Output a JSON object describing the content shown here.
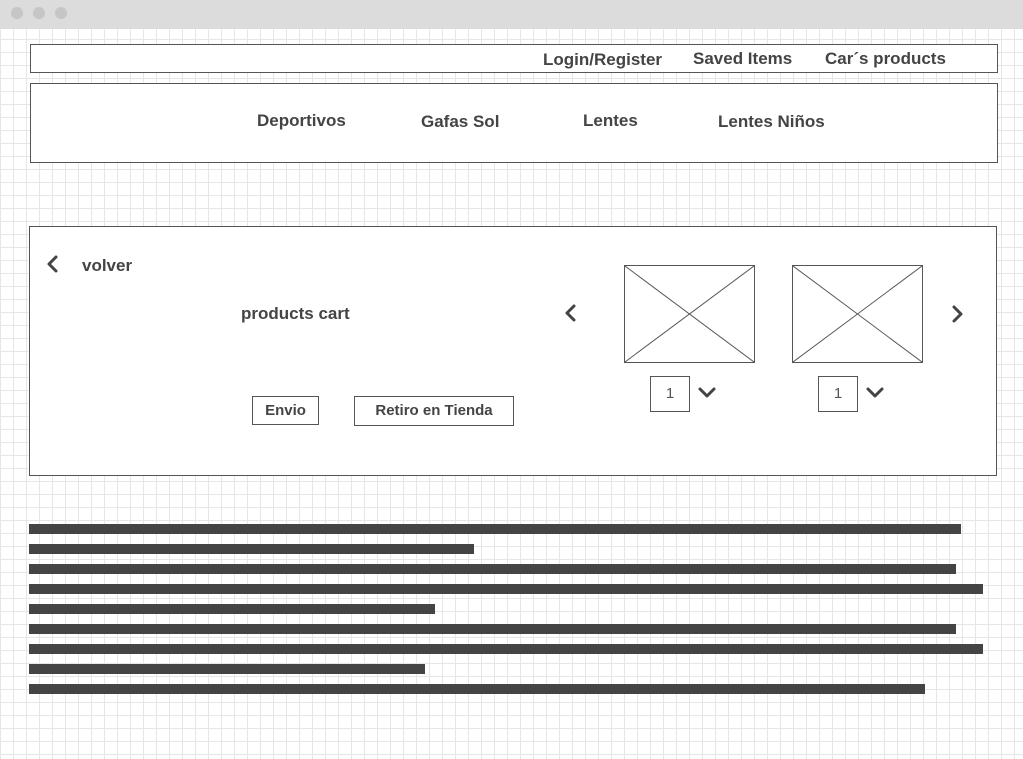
{
  "topbar": {
    "login": "Login/Register",
    "saved": "Saved Items",
    "cart": "Car´s products"
  },
  "nav": {
    "items": [
      "Deportivos",
      "Gafas Sol",
      "Lentes",
      "Lentes Niños"
    ]
  },
  "cart": {
    "back_label": "volver",
    "title": "products cart",
    "shipping_button": "Envio",
    "pickup_button": "Retiro en Tienda",
    "products": [
      {
        "quantity": "1"
      },
      {
        "quantity": "1"
      }
    ]
  },
  "text_block": {
    "line_count": 9,
    "line_lengths_fraction": [
      0.977,
      0.466,
      0.972,
      1.0,
      0.426,
      0.972,
      1.0,
      0.415,
      0.939
    ]
  },
  "icons": {
    "back": "chevron-left-icon",
    "carousel_prev": "chevron-left-icon",
    "carousel_next": "chevron-right-icon",
    "qty_dropdown": "chevron-down-icon",
    "image": "image-placeholder-icon"
  },
  "colors": {
    "ink": "#444444",
    "border": "#555555",
    "titlebar": "#dcdcdc"
  }
}
